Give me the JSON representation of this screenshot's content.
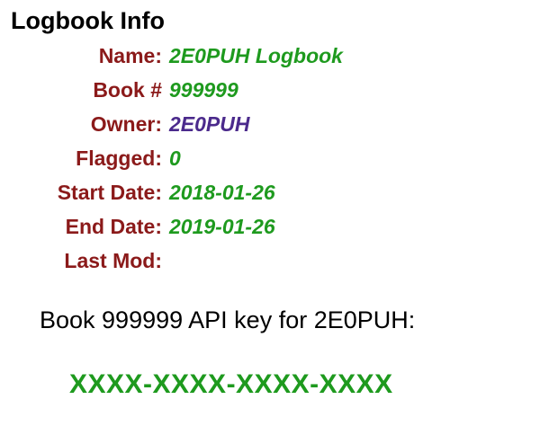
{
  "logbook_info": {
    "title": "Logbook Info",
    "rows": [
      {
        "label": "Name:",
        "value": "2E0PUH Logbook"
      },
      {
        "label": "Book #",
        "value": "999999"
      },
      {
        "label": "Owner:",
        "value": "2E0PUH"
      },
      {
        "label": "Flagged:",
        "value": "0"
      },
      {
        "label": "Start Date:",
        "value": "2018-01-26"
      },
      {
        "label": "End Date:",
        "value": "2019-01-26"
      },
      {
        "label": "Last Mod:",
        "value": ""
      }
    ]
  },
  "api": {
    "description": "Book 999999 API key for 2E0PUH:",
    "key": "XXXX-XXXX-XXXX-XXXX"
  },
  "colors": {
    "label": "#8b1a1a",
    "value": "#1e9a1e",
    "owner": "#4b2a8c",
    "heading": "#000000"
  }
}
